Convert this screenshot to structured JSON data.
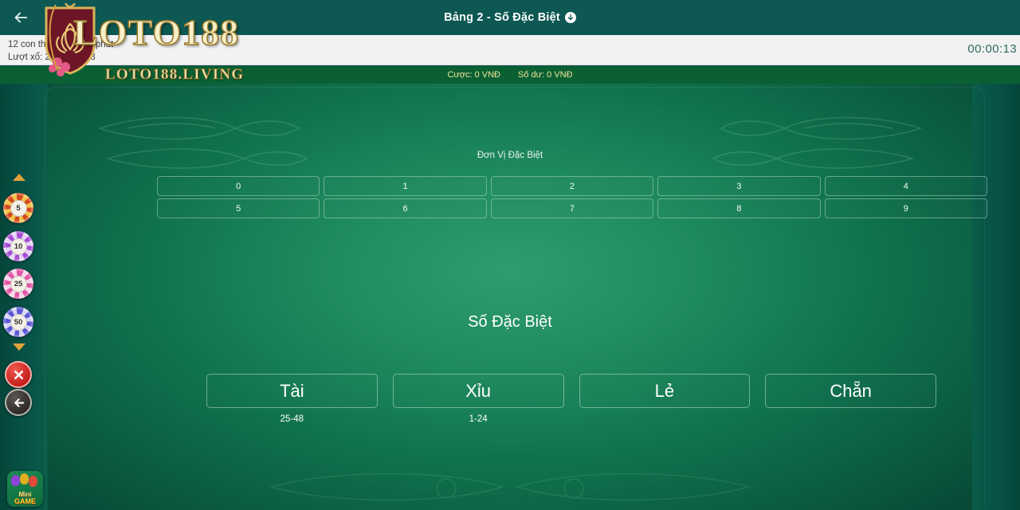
{
  "header": {
    "title": "Bảng 2 - Số Đặc Biệt",
    "back_icon": "arrow-left-icon",
    "title_icon": "arrow-down-circle-icon"
  },
  "info": {
    "line1": "12 con thưởng mỗi 1 phút",
    "line2": "Lượt xổ: 2025031158",
    "timer": "00:00:13"
  },
  "bet_strip": {
    "stake_label": "Cược: 0 VNĐ",
    "balance_label": "Số dư: 0 VNĐ"
  },
  "unit_section": {
    "label": "Đơn Vị Đặc Biệt",
    "numbers": [
      "0",
      "1",
      "2",
      "3",
      "4",
      "5",
      "6",
      "7",
      "8",
      "9"
    ]
  },
  "main_section": {
    "label": "Số Đặc Biệt",
    "options": [
      {
        "label": "Tài",
        "range": "25-48"
      },
      {
        "label": "Xỉu",
        "range": "1-24"
      },
      {
        "label": "Lẻ",
        "range": ""
      },
      {
        "label": "Chẵn",
        "range": ""
      }
    ]
  },
  "chip_rail": {
    "scroll_up_icon": "caret-up-icon",
    "scroll_down_icon": "caret-down-icon",
    "chips": [
      {
        "value": "5",
        "color": "#d4481f",
        "accent": "#f2c24a"
      },
      {
        "value": "10",
        "color": "#a64bd6",
        "accent": "#d9a6f2"
      },
      {
        "value": "25",
        "color": "#e053a5",
        "accent": "#f7b6da"
      },
      {
        "value": "50",
        "color": "#5a56d6",
        "accent": "#a6a3f0"
      }
    ],
    "clear_button": {
      "name": "clear-bets-button",
      "icon": "close-icon"
    },
    "undo_button": {
      "name": "undo-bet-button",
      "icon": "arrow-left-icon"
    }
  },
  "minigame": {
    "line1": "Mini",
    "line2": "GAME"
  },
  "logo": {
    "brand": "LOTO188",
    "domain": "LOTO188.LIVING"
  },
  "colors": {
    "header_bg": "#0d5853",
    "bet_strip_bg": "#0a6033",
    "felt_center": "#2e9d6e",
    "felt_edge": "#084a37",
    "gold_text": "#f3e49a",
    "timer_text": "#2d6b63"
  }
}
